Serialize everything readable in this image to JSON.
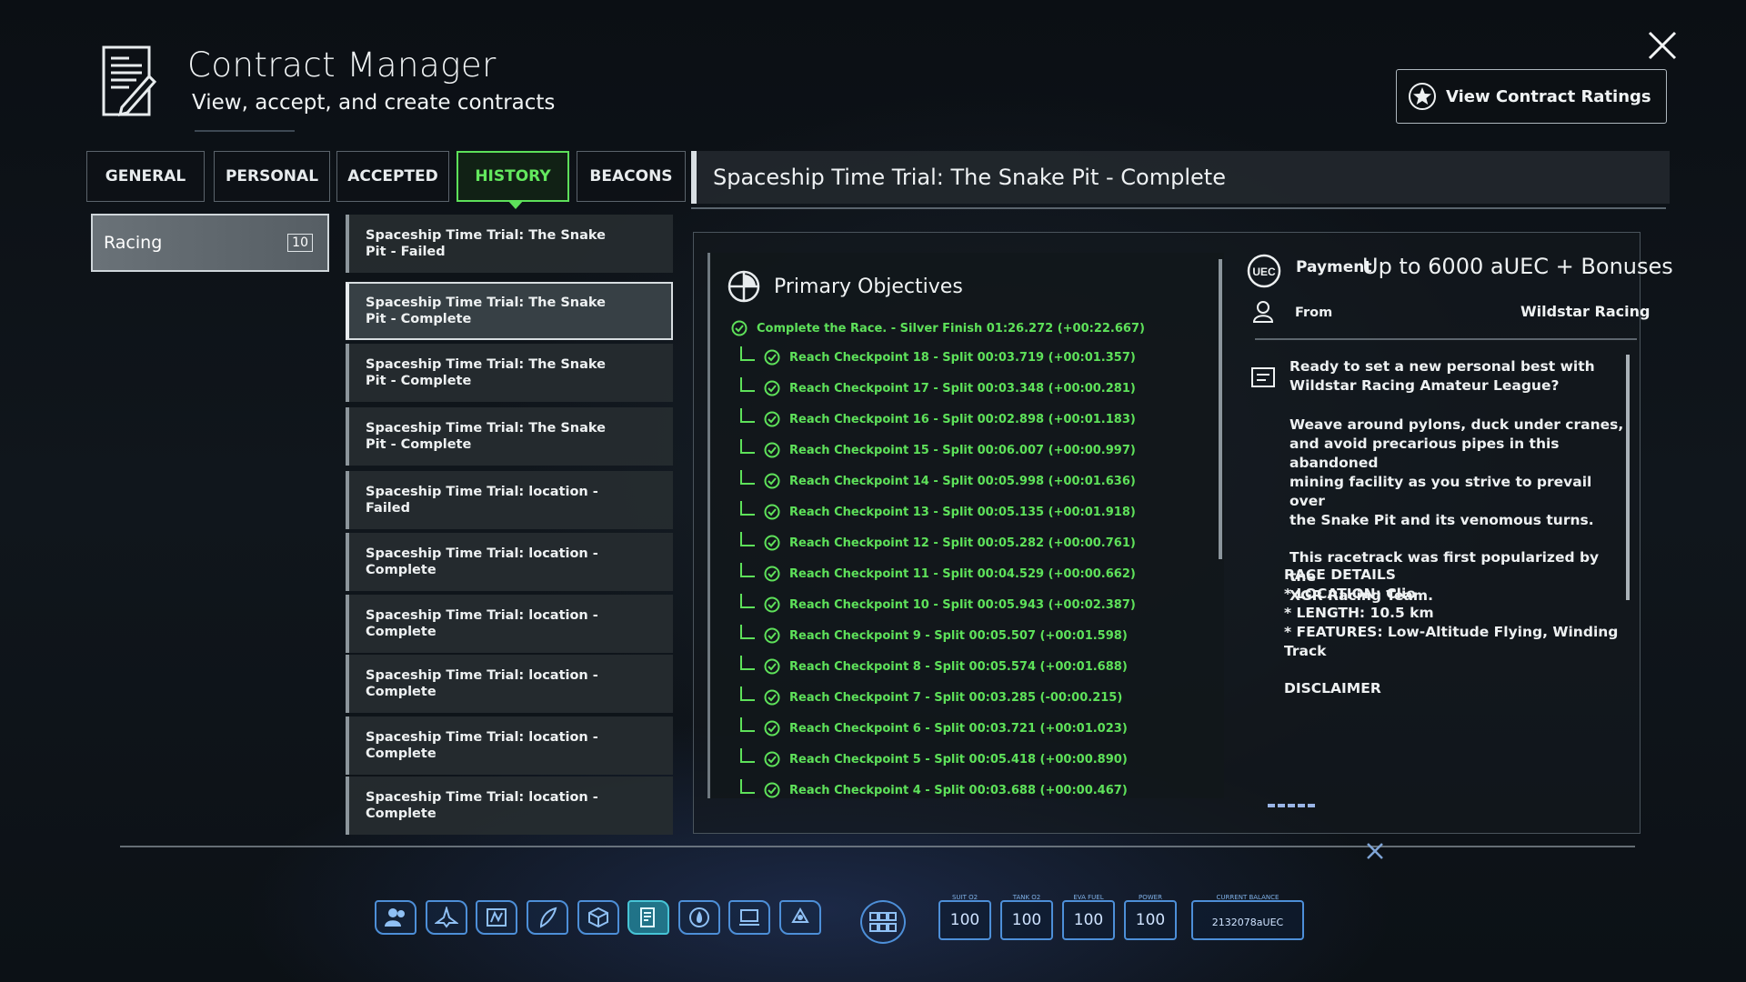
{
  "header": {
    "title": "Contract Manager",
    "subtitle": "View, accept, and create contracts",
    "ratings_label": "View Contract Ratings"
  },
  "tabs": [
    {
      "label": "GENERAL"
    },
    {
      "label": "PERSONAL"
    },
    {
      "label": "ACCEPTED"
    },
    {
      "label": "HISTORY",
      "active": true
    },
    {
      "label": "BEACONS"
    }
  ],
  "categories": [
    {
      "label": "Racing",
      "count": "10"
    }
  ],
  "contracts": [
    {
      "line1": "Spaceship Time Trial: The Snake",
      "line2": "Pit - Failed"
    },
    {
      "line1": "Spaceship Time Trial: The Snake",
      "line2": "Pit - Complete",
      "selected": true
    },
    {
      "line1": "Spaceship Time Trial: The Snake",
      "line2": "Pit - Complete"
    },
    {
      "line1": "Spaceship Time Trial: The Snake",
      "line2": "Pit - Complete"
    },
    {
      "line1": "Spaceship Time Trial: location -",
      "line2": "Failed"
    },
    {
      "line1": "Spaceship Time Trial: location -",
      "line2": "Complete"
    },
    {
      "line1": "Spaceship Time Trial: location -",
      "line2": "Complete"
    },
    {
      "line1": "Spaceship Time Trial: location -",
      "line2": "Complete"
    },
    {
      "line1": "Spaceship Time Trial: location -",
      "line2": "Complete"
    },
    {
      "line1": "Spaceship Time Trial: location -",
      "line2": "Complete"
    }
  ],
  "detail": {
    "title": "Spaceship Time Trial: The Snake Pit - Complete",
    "objectives_heading": "Primary Objectives",
    "objectives": [
      "Complete the Race. - Silver Finish 01:26.272 (+00:22.667)",
      "Reach Checkpoint 18 - Split 00:03.719 (+00:01.357)",
      "Reach Checkpoint 17 - Split 00:03.348 (+00:00.281)",
      "Reach Checkpoint 16 - Split 00:02.898 (+00:01.183)",
      "Reach Checkpoint 15 - Split 00:06.007 (+00:00.997)",
      "Reach Checkpoint 14 - Split 00:05.998 (+00:01.636)",
      "Reach Checkpoint 13 - Split 00:05.135 (+00:01.918)",
      "Reach Checkpoint 12 - Split 00:05.282 (+00:00.761)",
      "Reach Checkpoint 11 - Split 00:04.529 (+00:00.662)",
      "Reach Checkpoint 10 - Split 00:05.943 (+00:02.387)",
      "Reach Checkpoint 9 - Split 00:05.507 (+00:01.598)",
      "Reach Checkpoint 8 - Split 00:05.574 (+00:01.688)",
      "Reach Checkpoint 7 - Split 00:03.285 (-00:00.215)",
      "Reach Checkpoint 6 - Split 00:03.721 (+00:01.023)",
      "Reach Checkpoint 5 - Split 00:05.418 (+00:00.890)",
      "Reach Checkpoint 4 - Split 00:03.688 (+00:00.467)"
    ],
    "payment_label": "Payment",
    "payment_value": "Up to 6000 aUEC + Bonuses",
    "from_label": "From",
    "from_value": "Wildstar Racing",
    "description": {
      "p1a": "Ready to set a new personal best with",
      "p1b": "Wildstar Racing Amateur League?",
      "p2a": "Weave around pylons, duck under cranes,",
      "p2b": "and avoid precarious pipes in this abandoned",
      "p2c": "mining facility as you strive to prevail over",
      "p2d": "the Snake Pit and its venomous turns.",
      "p3a": "This racetrack was first popularized by the",
      "p3b": "XGR Racing Team.",
      "d0": "RACE DETAILS",
      "d1": "* LOCATION: Clio",
      "d2": "* LENGTH: 10.5 km",
      "d3a": "* FEATURES: Low-Altitude Flying, Winding",
      "d3b": "Track",
      "d4": "DISCLAIMER"
    }
  },
  "status_bar": [
    {
      "caption": "SUIT O2",
      "value": "100"
    },
    {
      "caption": "TANK O2",
      "value": "100"
    },
    {
      "caption": "EVA FUEL",
      "value": "100"
    },
    {
      "caption": "POWER",
      "value": "100"
    }
  ],
  "balance": {
    "caption": "CURRENT BALANCE",
    "value": "2132078aUEC"
  },
  "colors": {
    "accent_green": "#5ee15a",
    "hud_blue": "#4d8fd8"
  }
}
